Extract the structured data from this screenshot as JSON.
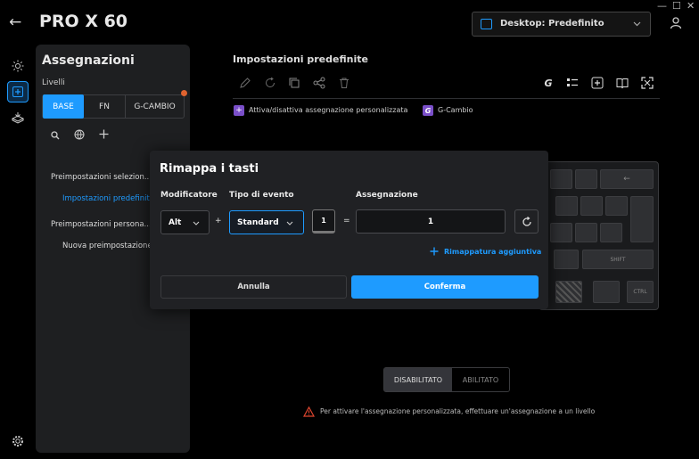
{
  "window": {
    "minimize": "—",
    "maximize": "☐",
    "close": "✕"
  },
  "header": {
    "back": "←",
    "title": "PRO X 60",
    "profile": "Desktop: Predefinito"
  },
  "sidebar": {
    "title": "Assegnazioni",
    "levels_label": "Livelli",
    "tabs": [
      "BASE",
      "FN",
      "G-CAMBIO"
    ],
    "sections": [
      {
        "label": "Preimpostazioni selezion...",
        "item": "Impostazioni predefinite"
      },
      {
        "label": "Preimpostazioni persona...",
        "item": "Nuova preimpostazione"
      }
    ]
  },
  "main": {
    "title": "Impostazioni predefinite",
    "legend": [
      {
        "label": "Attiva/disattiva assegnazione personalizzata",
        "color": "#7a4fc9"
      },
      {
        "label": "G-Cambio",
        "color": "#7a4fc9"
      }
    ],
    "toggle": {
      "off": "DISABILITATO",
      "on": "ABILITATO"
    },
    "warning": "Per attivare l'assegnazione personalizzata, effettuare un'assegnazione a un livello"
  },
  "keyboard": {
    "keys": [
      "←",
      "SHIFT",
      "CTRL"
    ]
  },
  "dialog": {
    "title": "Rimappa i tasti",
    "modifier_label": "Modificatore",
    "modifier_value": "Alt",
    "plus": "+",
    "event_label": "Tipo di evento",
    "event_value": "Standard",
    "small_value": "1",
    "equals": "=",
    "assign_label": "Assegnazione",
    "assign_value": "1",
    "additional": "Rimappatura aggiuntiva",
    "cancel": "Annulla",
    "confirm": "Conferma"
  },
  "colors": {
    "accent": "#1e9bff",
    "panel": "#1e1f21",
    "dialog": "#202124",
    "purple": "#7a4fc9",
    "warning": "#e0462f"
  }
}
